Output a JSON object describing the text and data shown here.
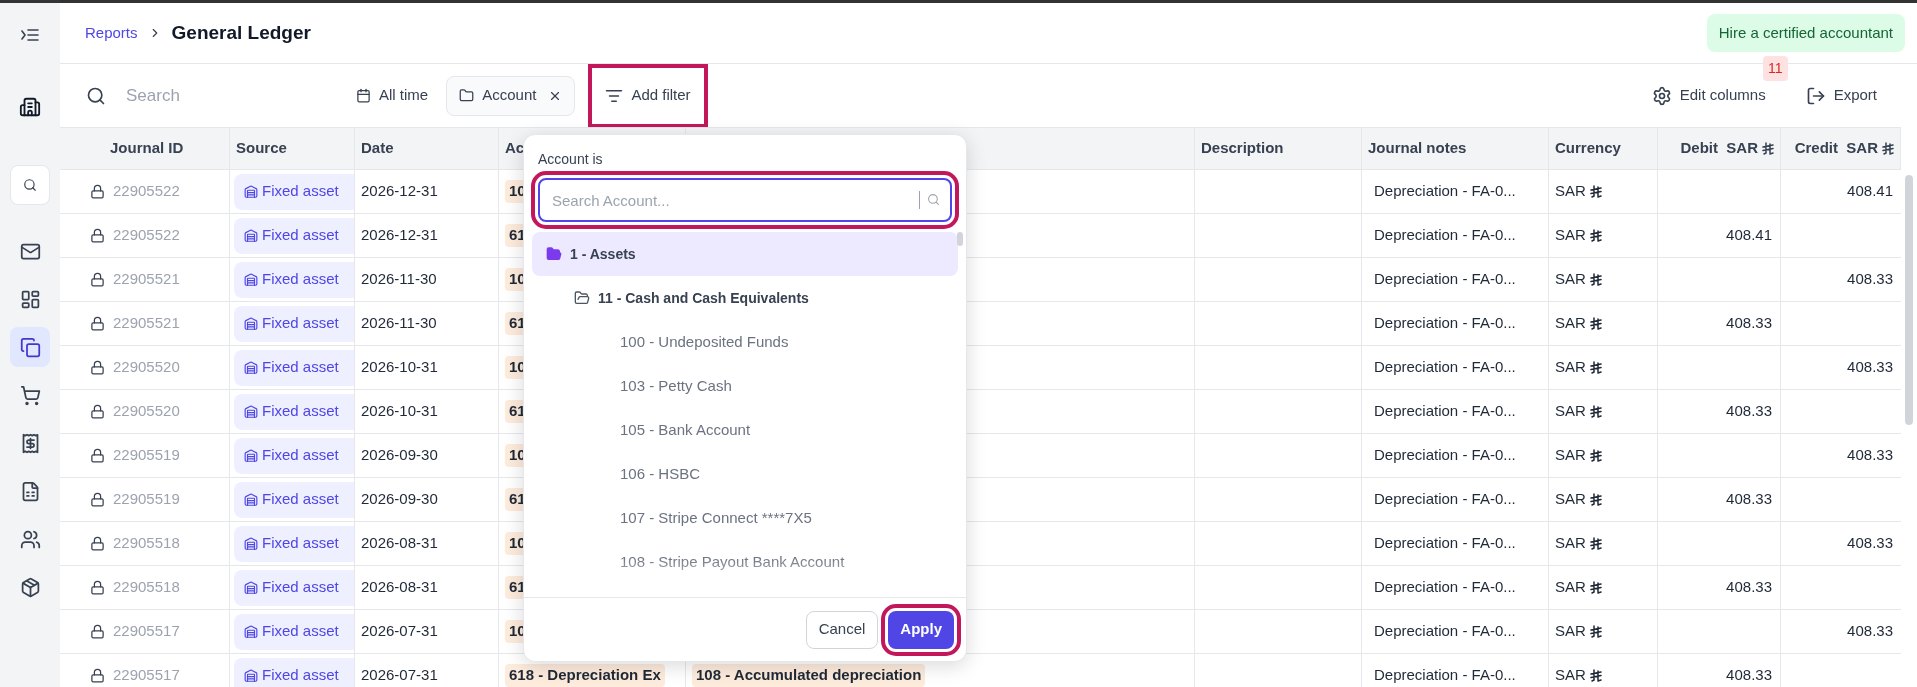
{
  "sidebar": {
    "items": [
      {
        "kind": "inbox",
        "selected": false
      },
      {
        "kind": "dashboard",
        "selected": false
      },
      {
        "kind": "documents",
        "selected": true
      },
      {
        "kind": "cart",
        "selected": false
      },
      {
        "kind": "receipt",
        "selected": false
      },
      {
        "kind": "sheet",
        "selected": false
      },
      {
        "kind": "people",
        "selected": false
      },
      {
        "kind": "package",
        "selected": false
      }
    ]
  },
  "breadcrumb": {
    "parent": "Reports",
    "title": "General Ledger"
  },
  "hire_button": "Hire a certified accountant",
  "toolbar": {
    "search": {
      "placeholder": "Search"
    },
    "date_filter": "All time",
    "filter_chip": "Account",
    "add_filter": {
      "label": "Add filter",
      "highlighted": true
    },
    "edit_columns": {
      "label": "Edit columns",
      "badge": "11"
    },
    "export": "Export"
  },
  "table": {
    "columns": [
      {
        "label": "Journal ID",
        "riyal": false
      },
      {
        "label": "Source",
        "riyal": false
      },
      {
        "label": "Date",
        "riyal": false
      },
      {
        "label": "Ac",
        "riyal": false
      },
      {
        "riyal": false
      },
      {
        "label": "Description",
        "riyal": false
      },
      {
        "label": "Journal notes",
        "riyal": false
      },
      {
        "label": "Currency",
        "riyal": false
      },
      {
        "label": "Debit  SAR",
        "riyal": true
      },
      {
        "label": "Credit  SAR",
        "riyal": true
      }
    ],
    "rows": [
      {
        "journal_id": "22905522",
        "source": "Fixed asset",
        "date": "2026-12-31",
        "account": "10",
        "notes": "Depreciation - FA-0...",
        "currency": "SAR",
        "credit": "408.41"
      },
      {
        "journal_id": "22905522",
        "source": "Fixed asset",
        "date": "2026-12-31",
        "account": "61",
        "notes": "Depreciation - FA-0...",
        "currency": "SAR",
        "debit": "408.41"
      },
      {
        "journal_id": "22905521",
        "source": "Fixed asset",
        "date": "2026-11-30",
        "account": "10",
        "notes": "Depreciation - FA-0...",
        "currency": "SAR",
        "credit": "408.33"
      },
      {
        "journal_id": "22905521",
        "source": "Fixed asset",
        "date": "2026-11-30",
        "account": "61",
        "notes": "Depreciation - FA-0...",
        "currency": "SAR",
        "debit": "408.33"
      },
      {
        "journal_id": "22905520",
        "source": "Fixed asset",
        "date": "2026-10-31",
        "account": "10",
        "notes": "Depreciation - FA-0...",
        "currency": "SAR",
        "credit": "408.33"
      },
      {
        "journal_id": "22905520",
        "source": "Fixed asset",
        "date": "2026-10-31",
        "account": "61",
        "notes": "Depreciation - FA-0...",
        "currency": "SAR",
        "debit": "408.33"
      },
      {
        "journal_id": "22905519",
        "source": "Fixed asset",
        "date": "2026-09-30",
        "account": "10",
        "notes": "Depreciation - FA-0...",
        "currency": "SAR",
        "credit": "408.33"
      },
      {
        "journal_id": "22905519",
        "source": "Fixed asset",
        "date": "2026-09-30",
        "account": "61",
        "notes": "Depreciation - FA-0...",
        "currency": "SAR",
        "debit": "408.33"
      },
      {
        "journal_id": "22905518",
        "source": "Fixed asset",
        "date": "2026-08-31",
        "account": "10",
        "notes": "Depreciation - FA-0...",
        "currency": "SAR",
        "credit": "408.33"
      },
      {
        "journal_id": "22905518",
        "source": "Fixed asset",
        "date": "2026-08-31",
        "account": "61",
        "notes": "Depreciation - FA-0...",
        "currency": "SAR",
        "debit": "408.33"
      },
      {
        "journal_id": "22905517",
        "source": "Fixed asset",
        "date": "2026-07-31",
        "account": "10",
        "notes": "Depreciation - FA-0...",
        "currency": "SAR",
        "credit": "408.33"
      },
      {
        "journal_id": "22905517",
        "source": "Fixed asset",
        "date": "2026-07-31",
        "account": "618 - Depreciation Ex",
        "account_2": "108 - Accumulated depreciation",
        "notes": "Depreciation - FA-0...",
        "currency": "SAR",
        "debit": "408.33"
      }
    ]
  },
  "account_filter": {
    "label": "Account is",
    "search": {
      "placeholder": "Search Account...",
      "highlighted": true
    },
    "tree": [
      {
        "label": "1 - Assets",
        "selected": true,
        "children": [
          {
            "label": "11 - Cash and Cash Equivalents",
            "selected": false,
            "children": [
              {
                "label": "100 - Undeposited Funds",
                "selected": false
              },
              {
                "label": "103 - Petty Cash",
                "selected": false
              },
              {
                "label": "105 - Bank Account",
                "selected": false
              },
              {
                "label": "106 - HSBC",
                "selected": false
              },
              {
                "label": "107 - Stripe Connect ****7X5",
                "selected": false
              },
              {
                "label": "108 - Stripe Payout Bank Account",
                "selected": false
              }
            ]
          }
        ]
      }
    ],
    "cancel": "Cancel",
    "apply": {
      "label": "Apply",
      "highlighted": true
    }
  }
}
